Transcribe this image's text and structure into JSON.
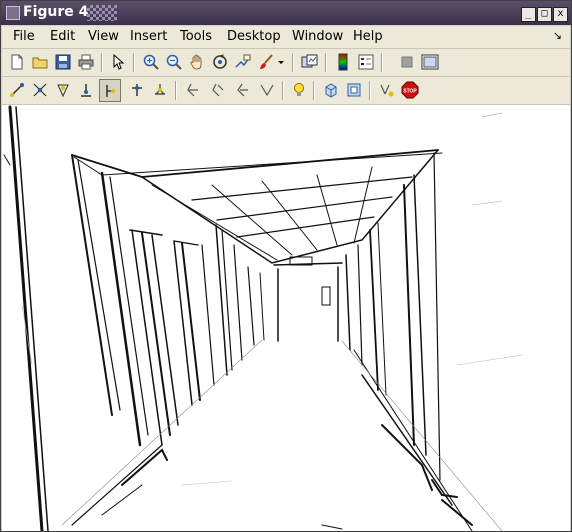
{
  "window": {
    "title": "Figure 4"
  },
  "window_controls": {
    "minimize": "_",
    "maximize": "□",
    "close": "x"
  },
  "menubar": {
    "items": [
      {
        "label": "File"
      },
      {
        "label": "Edit"
      },
      {
        "label": "View"
      },
      {
        "label": "Insert"
      },
      {
        "label": "Tools"
      },
      {
        "label": "Desktop"
      },
      {
        "label": "Window"
      },
      {
        "label": "Help"
      }
    ],
    "dock_arrow": "↘"
  },
  "toolbar1": {
    "icons": [
      "new-figure-icon",
      "open-file-icon",
      "save-icon",
      "print-icon",
      "pointer-icon",
      "zoom-in-icon",
      "zoom-out-icon",
      "pan-hand-icon",
      "rotate-3d-icon",
      "data-cursor-icon",
      "brush-icon",
      "brush-dropdown-icon",
      "link-plot-icon",
      "colorbar-icon",
      "legend-icon",
      "hide-plot-tools-icon",
      "show-plot-tools-icon"
    ]
  },
  "toolbar2": {
    "icons": [
      "edge-tool-1-icon",
      "edge-tool-2-icon",
      "edge-tool-3-icon",
      "edge-tool-4-icon",
      "edge-tool-5-icon",
      "edge-tool-6-icon",
      "edge-tool-7-icon",
      "vertex-tool-1-icon",
      "vertex-tool-2-icon",
      "vertex-tool-3-icon",
      "vertex-tool-4-icon",
      "light-bulb-icon",
      "cube-icon",
      "camera-icon",
      "extra-tool-icon",
      "stop-icon"
    ],
    "stop_label": "STOP"
  },
  "figure": {
    "description_alt": "edge-detected corridor image"
  }
}
